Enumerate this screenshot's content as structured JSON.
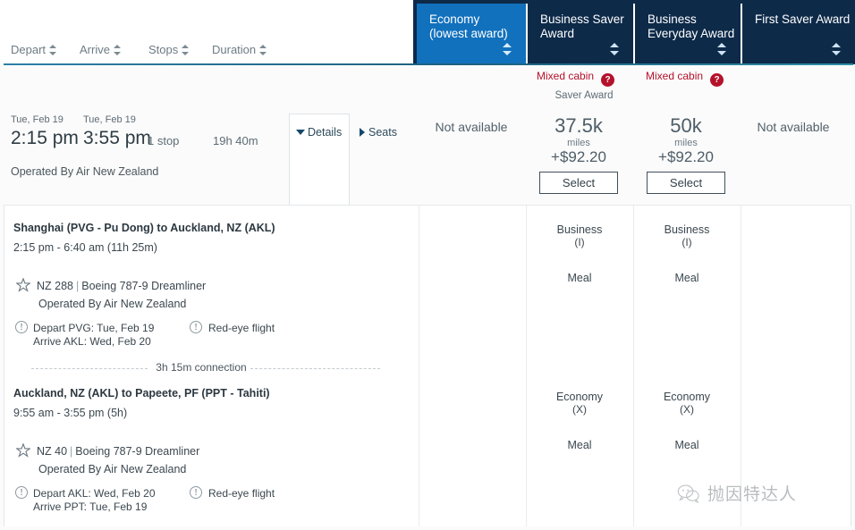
{
  "tabs": [
    {
      "line1": "Economy",
      "line2": "(lowest award)",
      "active": true
    },
    {
      "line1": "Business Saver",
      "line2": "Award",
      "active": false
    },
    {
      "line1": "Business",
      "line2": "Everyday Award",
      "active": false
    },
    {
      "line1": "First Saver Award",
      "line2": "",
      "active": false
    }
  ],
  "sort": [
    {
      "label": "Depart"
    },
    {
      "label": "Arrive"
    },
    {
      "label": "Stops"
    },
    {
      "label": "Duration"
    }
  ],
  "notices": {
    "mixed_cabin_label": "Mixed cabin",
    "help_icon": "question-mark-icon",
    "help_glyph": "?",
    "saver_award_label": "Saver Award"
  },
  "summary": {
    "depart_date": "Tue, Feb 19",
    "depart_time": "2:15 pm",
    "arrive_date": "Tue, Feb 19",
    "arrive_time": "3:55 pm",
    "stops": "1 stop",
    "duration": "19h 40m",
    "operated_by": "Operated By Air New Zealand",
    "details_label": "Details",
    "seats_label": "Seats"
  },
  "fares": [
    {
      "available": false,
      "not_available_text": "Not available"
    },
    {
      "available": true,
      "miles": "37.5k",
      "miles_word": "miles",
      "cash": "+$92.20",
      "select_label": "Select"
    },
    {
      "available": true,
      "miles": "50k",
      "miles_word": "miles",
      "cash": "+$92.20",
      "select_label": "Select"
    },
    {
      "available": false,
      "not_available_text": "Not available"
    }
  ],
  "segments": [
    {
      "route": "Shanghai (PVG - Pu Dong) to Auckland, NZ (AKL)",
      "times": "2:15 pm - 6:40 am (11h 25m)",
      "flight_number": "NZ 288",
      "aircraft": "Boeing 787-9 Dreamliner",
      "operated_by": "Operated By Air New Zealand",
      "depart_note": "Depart PVG: Tue, Feb 19",
      "arrive_note": "Arrive AKL: Wed, Feb 20",
      "red_eye_note": "Red-eye flight",
      "cabins": [
        {
          "name": "Business",
          "code": "(I)",
          "meal": "Meal"
        },
        {
          "name": "Business",
          "code": "(I)",
          "meal": "Meal"
        }
      ]
    },
    {
      "route": "Auckland, NZ (AKL) to Papeete, PF (PPT - Tahiti)",
      "times": "9:55 am - 3:55 pm (5h)",
      "flight_number": "NZ 40",
      "aircraft": "Boeing 787-9 Dreamliner",
      "operated_by": "Operated By Air New Zealand",
      "depart_note": "Depart AKL: Wed, Feb 20",
      "arrive_note": "Arrive PPT: Tue, Feb 19",
      "red_eye_note": "Red-eye flight",
      "cabins": [
        {
          "name": "Economy",
          "code": "(X)",
          "meal": "Meal"
        },
        {
          "name": "Economy",
          "code": "(X)",
          "meal": "Meal"
        }
      ]
    }
  ],
  "connection": {
    "text": "3h 15m connection"
  },
  "watermark": {
    "text": "抛因特达人",
    "icon": "wechat-icon"
  },
  "colors": {
    "tab_inactive": "#0d2a49",
    "tab_active": "#1271bd",
    "notice_red": "#b4122b",
    "rule_teal": "#2d7fa8"
  }
}
